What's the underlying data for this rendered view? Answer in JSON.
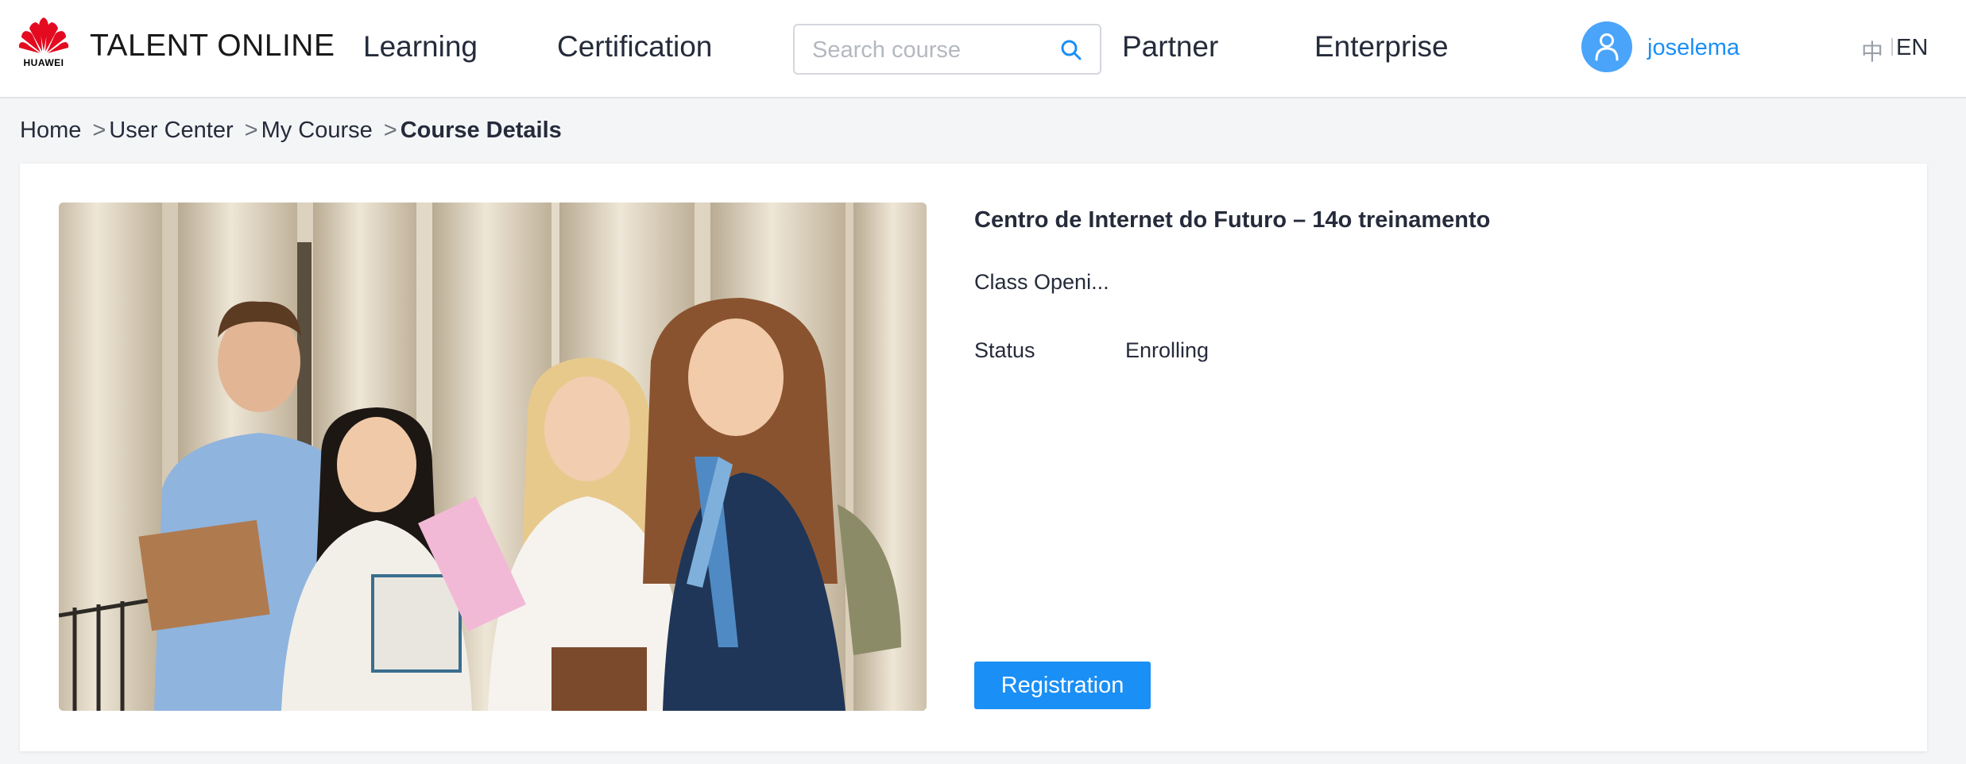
{
  "header": {
    "logo_text": "HUAWEI",
    "brand": "TALENT ONLINE",
    "nav": {
      "learning": "Learning",
      "certification": "Certification",
      "partner": "Partner",
      "enterprise": "Enterprise"
    },
    "search": {
      "placeholder": "Search course",
      "value": ""
    },
    "user": {
      "name": "joselema"
    },
    "language": {
      "zh": "中",
      "en": "EN"
    }
  },
  "breadcrumb": {
    "home": "Home",
    "user_center": "User Center",
    "my_course": "My Course",
    "current": "Course Details",
    "separator": ">"
  },
  "course": {
    "title": "Centro de Internet do Futuro – 14o treinamento",
    "class_opening_label": "Class Openi...",
    "status_label": "Status",
    "status_value": "Enrolling",
    "register_label": "Registration"
  },
  "colors": {
    "accent": "#1a8ff5",
    "huawei_red": "#e40a20",
    "avatar": "#4aa4f9"
  },
  "icons": {
    "logo": "huawei-logo",
    "search": "search-icon",
    "avatar": "user-icon"
  }
}
